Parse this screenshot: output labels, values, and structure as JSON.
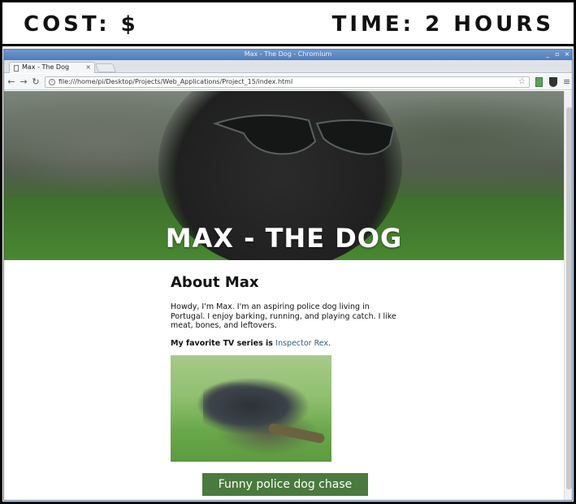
{
  "banner": {
    "cost": "COST: $",
    "time": "TIME: 2 HOURS"
  },
  "browser": {
    "window_title": "Max - The Dog - Chromium",
    "tab_label": "Max - The Dog",
    "tab_close": "×",
    "url": "file:///home/pi/Desktop/Projects/Web_Applications/Project_15/index.html",
    "controls": {
      "minimize": "_",
      "maximize": "▫",
      "close": "×"
    }
  },
  "page": {
    "hero_title": "MAX - THE DOG",
    "about_heading": "About Max",
    "intro": "Howdy, I'm Max. I'm an aspiring police dog living in Portugal. I enjoy barking, running, and playing catch. I like meat, bones, and leftovers.",
    "favorite_prefix": "My favorite TV series is ",
    "favorite_link": "Inspector Rex",
    "favorite_suffix": ".",
    "button_label": "Funny police dog chase"
  },
  "icons": {
    "back": "arrow-left-icon",
    "forward": "arrow-right-icon",
    "reload": "reload-icon",
    "info": "info-icon",
    "star": "star-icon",
    "menu": "menu-icon",
    "tab_doc": "document-icon"
  },
  "colors": {
    "titlebar": "#4f7bb8",
    "button": "#4a7a3d",
    "link": "#2c5f86"
  }
}
